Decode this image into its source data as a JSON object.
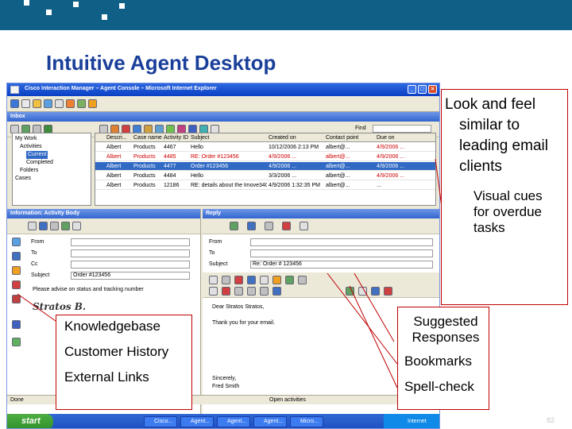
{
  "slide": {
    "title": "Intuitive Agent Desktop",
    "page_number": "82",
    "callouts": {
      "look_and_feel": "Look and feel similar to leading email clients",
      "visual_cues": "Visual cues for overdue tasks",
      "kb_items": [
        "Knowledgebase",
        "Customer History",
        "External Links"
      ],
      "suggested": "Suggested Responses",
      "bookmarks": "Bookmarks",
      "spellcheck": "Spell-check"
    }
  },
  "screen": {
    "window_title": "Cisco Interaction Manager – Agent Console – Microsoft Internet Explorer",
    "inbox_label": "Inbox",
    "find_label": "Find",
    "tree": [
      "My Work",
      "Activities",
      "Current",
      "Completed",
      "Folders",
      "Cases"
    ],
    "grid_columns": [
      "Descri...",
      "Case name",
      "Activity ID",
      "Subject",
      "Created on",
      "Contact point",
      "Due on"
    ],
    "grid_rows": [
      [
        "Albert",
        "Products",
        "4467",
        "Hello",
        "10/12/2006 2:13 PM",
        "albert@...",
        "4/9/2006 ..."
      ],
      [
        "Albert",
        "Products",
        "4485",
        "RE: Order #123456",
        "4/9/2006 ...",
        "albert@...",
        "4/9/2006 ..."
      ],
      [
        "Albert",
        "Products",
        "4477",
        "Order #123456",
        "4/9/2006 ...",
        "albert@...",
        "4/9/2006 ..."
      ],
      [
        "Albert",
        "Products",
        "4484",
        "Hello",
        "3/3/2006 ...",
        "albert@...",
        "4/9/2006 ..."
      ],
      [
        "Albert",
        "Products",
        "12186",
        "RE: details about the Imove3400 plan",
        "4/9/2006 1:32:35 PM",
        "albert@...",
        "..."
      ]
    ],
    "info_header": "Information: Activity Body",
    "reply_header": "Reply",
    "info_fields": {
      "from_label": "From",
      "to_label": "To",
      "cc_label": "Cc",
      "subject_label": "Subject",
      "subject_value": "Order #123456",
      "body": "Please advise on status and tracking number",
      "signature": "Stratos B."
    },
    "reply_fields": {
      "from_label": "From",
      "to_label": "To",
      "subject_label": "Subject",
      "subject_value": "Re: Order # 123456",
      "greeting": "Dear Stratos Stratos,",
      "thanks": "Thank you for your email.",
      "closing": "Sincerely,",
      "name": "Fred Smith"
    },
    "status_left": "Done",
    "status_right": "Open activities",
    "taskbar": {
      "start": "start",
      "items": [
        "Cisco...",
        "Agent...",
        "Agent...",
        "Agent...",
        "Micro..."
      ],
      "tray": "Internet"
    }
  }
}
